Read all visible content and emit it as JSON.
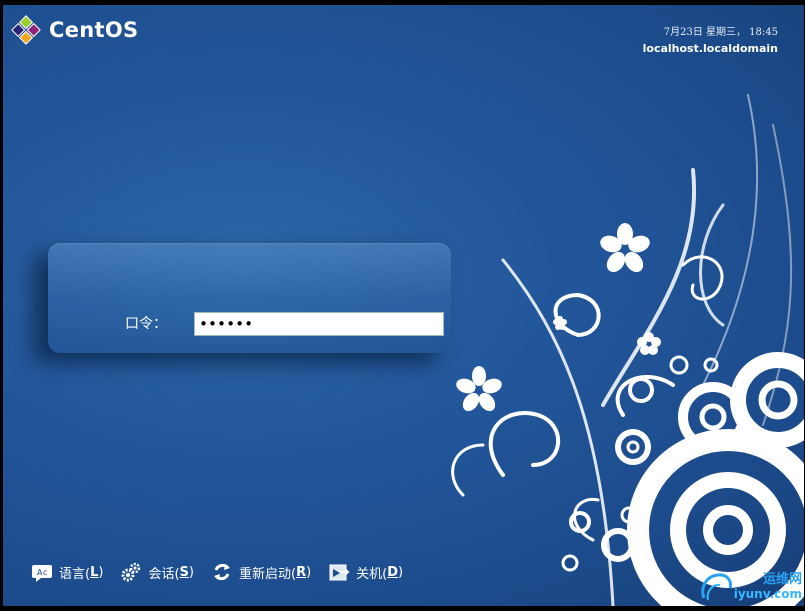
{
  "brand": {
    "name": "CentOS"
  },
  "clock": {
    "date": "7月23日 星期三， 18:45",
    "host": "localhost.localdomain"
  },
  "login": {
    "password_label": "口令：",
    "password_value": "••••••"
  },
  "bottom_bar": {
    "items": [
      {
        "label": "语言(",
        "key": "L",
        "suffix": ")",
        "icon": "language-icon"
      },
      {
        "label": "会话(",
        "key": "S",
        "suffix": ")",
        "icon": "session-gears-icon"
      },
      {
        "label": "重新启动(",
        "key": "R",
        "suffix": ")",
        "icon": "restart-icon"
      },
      {
        "label": "关机(",
        "key": "D",
        "suffix": ")",
        "icon": "shutdown-icon"
      }
    ]
  },
  "watermark": {
    "text_cn": "运维网",
    "url": "iyunv.com"
  },
  "colors": {
    "background": "#22569a",
    "panel": "#3d76b4",
    "text": "#ffffff",
    "watermark": "#2aa1f0"
  }
}
